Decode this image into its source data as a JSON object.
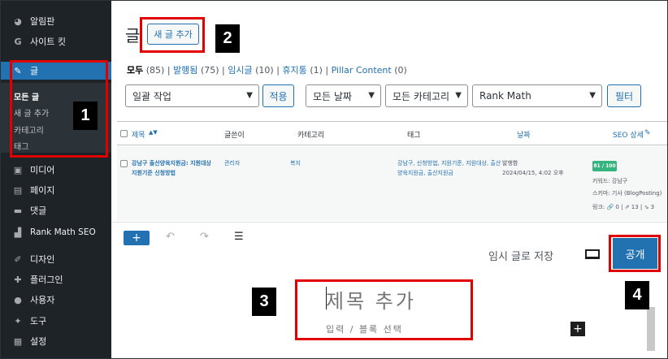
{
  "sidebar": {
    "items": [
      {
        "name": "dashboard",
        "icon": "dashboard-icon",
        "glyph": "◕",
        "label": "알림판"
      },
      {
        "name": "site-kit",
        "icon": "google-g-icon",
        "glyph": "G",
        "label": "사이트 킷"
      },
      {
        "name": "posts",
        "icon": "pushpin-icon",
        "glyph": "✎",
        "label": "글"
      },
      {
        "name": "media",
        "icon": "media-icon",
        "glyph": "▣",
        "label": "미디어"
      },
      {
        "name": "pages",
        "icon": "page-icon",
        "glyph": "▤",
        "label": "페이지"
      },
      {
        "name": "comments",
        "icon": "comment-icon",
        "glyph": "▬",
        "label": "댓글"
      },
      {
        "name": "rank-math",
        "icon": "rank-math-icon",
        "glyph": "▟",
        "label": "Rank Math SEO"
      },
      {
        "name": "appearance",
        "icon": "paintbrush-icon",
        "glyph": "✐",
        "label": "디자인"
      },
      {
        "name": "plugins",
        "icon": "plugin-icon",
        "glyph": "✚",
        "label": "플러그인"
      },
      {
        "name": "users",
        "icon": "user-icon",
        "glyph": "●",
        "label": "사용자"
      },
      {
        "name": "tools",
        "icon": "wrench-icon",
        "glyph": "✦",
        "label": "도구"
      },
      {
        "name": "settings",
        "icon": "settings-icon",
        "glyph": "▦",
        "label": "설정"
      }
    ],
    "submenu": [
      "모든 글",
      "새 글 추가",
      "카테고리",
      "태그"
    ]
  },
  "header": {
    "title": "글",
    "add_new": "새 글 추가"
  },
  "filters": {
    "all": "모두",
    "all_count": "(85)",
    "published": "발행됨",
    "published_count": "(75)",
    "drafts": "임시글",
    "drafts_count": "(10)",
    "trash": "휴지통",
    "trash_count": "(1)",
    "pillar": "Pillar Content",
    "pillar_count": "(0)",
    "sep": "|"
  },
  "toolbar": {
    "bulk_action": "일괄 작업",
    "apply": "적용",
    "all_dates": "모든 날짜",
    "all_categories": "모든 카테고리",
    "rank_math": "Rank Math",
    "filter": "필터"
  },
  "table": {
    "headers": {
      "title": "제목",
      "author": "글쓴이",
      "categories": "카테고리",
      "tags": "태그",
      "date": "날짜",
      "seo": "SEO 상세"
    },
    "row": {
      "title_line1": "강남구 출산양육지원금: 지원대상",
      "title_line2": "지원기준 신청방법",
      "author": "관리자",
      "category": "복지",
      "tags_line1": "강남구, 신청방법, 지원기준, 지원대상, 출산",
      "tags_line2": "양육지원금, 출산지원금",
      "date_status": "발행함",
      "date_value": "2024/04/15, 4:02 오후",
      "seo_score": "81 / 100",
      "keyword": "키워드: 강남구",
      "schema": "스키마: 기사 (BlogPosting)",
      "links": "링크: 🔗 0 | ⇗ 13 | ⇘ 3"
    }
  },
  "editor": {
    "inserter": "+",
    "undo": "↶",
    "redo": "↷",
    "outline": "☰",
    "save_draft": "임시 글로 저장",
    "publish": "공개",
    "title_placeholder": "제목 추가",
    "block_placeholder": "입력 / 블록 선택",
    "block_add": "+"
  },
  "annotations": [
    "1",
    "2",
    "3",
    "4"
  ],
  "colors": {
    "sidebar_bg": "#1d2327",
    "accent": "#2271b1",
    "highlight": "#e00000",
    "seo_good": "#36b37e"
  }
}
